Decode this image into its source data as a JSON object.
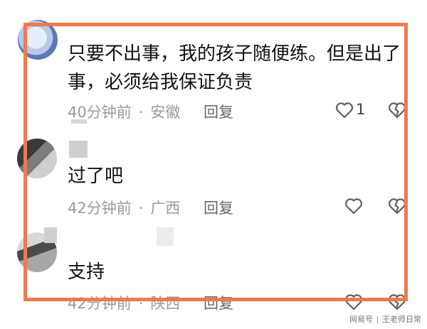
{
  "comments": [
    {
      "text_line1": "只要不出事，我的孩子随便练。但是出了",
      "text_line2": "事，必须给我保证负责",
      "time": "40分钟前",
      "location": "安徽",
      "reply": "回复",
      "likes": "1"
    },
    {
      "text_line1": "过了吧",
      "time": "42分钟前",
      "location": "广西",
      "reply": "回复"
    },
    {
      "text_line1": "支持",
      "time": "42分钟前",
      "location": "陕西",
      "reply": "回复"
    }
  ],
  "icons": {
    "like": "heart-outline-icon",
    "dislike": "broken-heart-icon"
  },
  "colors": {
    "highlight_border": "#f07a4c",
    "meta_text": "#9a9a9a"
  },
  "watermark": {
    "source": "网易号",
    "author": "王老师日常"
  }
}
